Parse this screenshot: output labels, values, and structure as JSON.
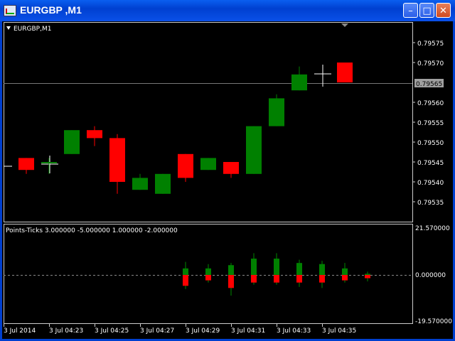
{
  "window": {
    "title": "EURGBP ,M1",
    "min_glyph": "–",
    "max_glyph": "□",
    "close_glyph": "✕"
  },
  "chart": {
    "label": "EURGBP,M1",
    "current_price": "0.79565",
    "price_ticks": [
      "0.79575",
      "0.79570",
      "0.79560",
      "0.79555",
      "0.79550",
      "0.79545",
      "0.79540",
      "0.79535"
    ],
    "colors": {
      "bull": "#008000",
      "bear": "#ff0000",
      "grid": "#ffffff"
    }
  },
  "indicator": {
    "label": "Points-Ticks  3.000000 -5.000000 1.000000 -2.000000",
    "top": "21.570000",
    "zero": "0.000000",
    "bottom": "-19.570000"
  },
  "time_axis": [
    "3 Jul 2014",
    "3 Jul 04:23",
    "3 Jul 04:25",
    "3 Jul 04:27",
    "3 Jul 04:29",
    "3 Jul 04:31",
    "3 Jul 04:33",
    "3 Jul 04:35"
  ],
  "chart_data": {
    "type": "candlestick",
    "price_candles": [
      {
        "x": 0,
        "o": 0.79543,
        "h": 0.79547,
        "l": 0.79542,
        "c": 0.79543
      },
      {
        "x": 1,
        "o": 0.79546,
        "h": 0.79546,
        "l": 0.79542,
        "c": 0.79543
      },
      {
        "x": 2,
        "o": 0.79545,
        "h": 0.79546,
        "l": 0.79542,
        "c": 0.79545
      },
      {
        "x": 3,
        "o": 0.79547,
        "h": 0.79553,
        "l": 0.79547,
        "c": 0.79553
      },
      {
        "x": 4,
        "o": 0.79553,
        "h": 0.79554,
        "l": 0.79549,
        "c": 0.79551
      },
      {
        "x": 5,
        "o": 0.79551,
        "h": 0.79552,
        "l": 0.79537,
        "c": 0.7954
      },
      {
        "x": 6,
        "o": 0.79538,
        "h": 0.79542,
        "l": 0.79538,
        "c": 0.79541
      },
      {
        "x": 7,
        "o": 0.79537,
        "h": 0.79542,
        "l": 0.79537,
        "c": 0.79542
      },
      {
        "x": 8,
        "o": 0.79547,
        "h": 0.79547,
        "l": 0.7954,
        "c": 0.79541
      },
      {
        "x": 9,
        "o": 0.79543,
        "h": 0.79546,
        "l": 0.79543,
        "c": 0.79546
      },
      {
        "x": 10,
        "o": 0.79545,
        "h": 0.79545,
        "l": 0.79541,
        "c": 0.79542
      },
      {
        "x": 11,
        "o": 0.79542,
        "h": 0.79554,
        "l": 0.79542,
        "c": 0.79554
      },
      {
        "x": 12,
        "o": 0.79554,
        "h": 0.79562,
        "l": 0.79554,
        "c": 0.79561
      },
      {
        "x": 13,
        "o": 0.79563,
        "h": 0.79569,
        "l": 0.79563,
        "c": 0.79567
      },
      {
        "x": 14,
        "o": 0.79568,
        "h": 0.79569,
        "l": 0.79565,
        "c": 0.79568
      },
      {
        "x": 15,
        "o": 0.7957,
        "h": 0.7957,
        "l": 0.79565,
        "c": 0.79565
      }
    ],
    "indicator_bars": [
      {
        "x": 8,
        "up_hi": 6.0,
        "up_body": 3.0,
        "dn_body": -5.0,
        "dn_lo": -6.5
      },
      {
        "x": 9,
        "up_hi": 5.0,
        "up_body": 3.0,
        "dn_body": -2.5,
        "dn_lo": -3.5
      },
      {
        "x": 10,
        "up_hi": 5.5,
        "up_body": 4.5,
        "dn_body": -6.0,
        "dn_lo": -9.5
      },
      {
        "x": 11,
        "up_hi": 10.0,
        "up_body": 7.5,
        "dn_body": -3.5,
        "dn_lo": -4.5
      },
      {
        "x": 12,
        "up_hi": 10.0,
        "up_body": 7.5,
        "dn_body": -3.5,
        "dn_lo": -4.5
      },
      {
        "x": 13,
        "up_hi": 7.0,
        "up_body": 5.5,
        "dn_body": -3.5,
        "dn_lo": -5.5
      },
      {
        "x": 14,
        "up_hi": 6.5,
        "up_body": 5.0,
        "dn_body": -3.5,
        "dn_lo": -6.0
      },
      {
        "x": 15,
        "up_hi": 5.5,
        "up_body": 3.0,
        "dn_body": -2.5,
        "dn_lo": -3.5
      },
      {
        "x": 16,
        "up_hi": 1.5,
        "up_body": 0.5,
        "dn_body": -1.5,
        "dn_lo": -3.0
      }
    ]
  }
}
